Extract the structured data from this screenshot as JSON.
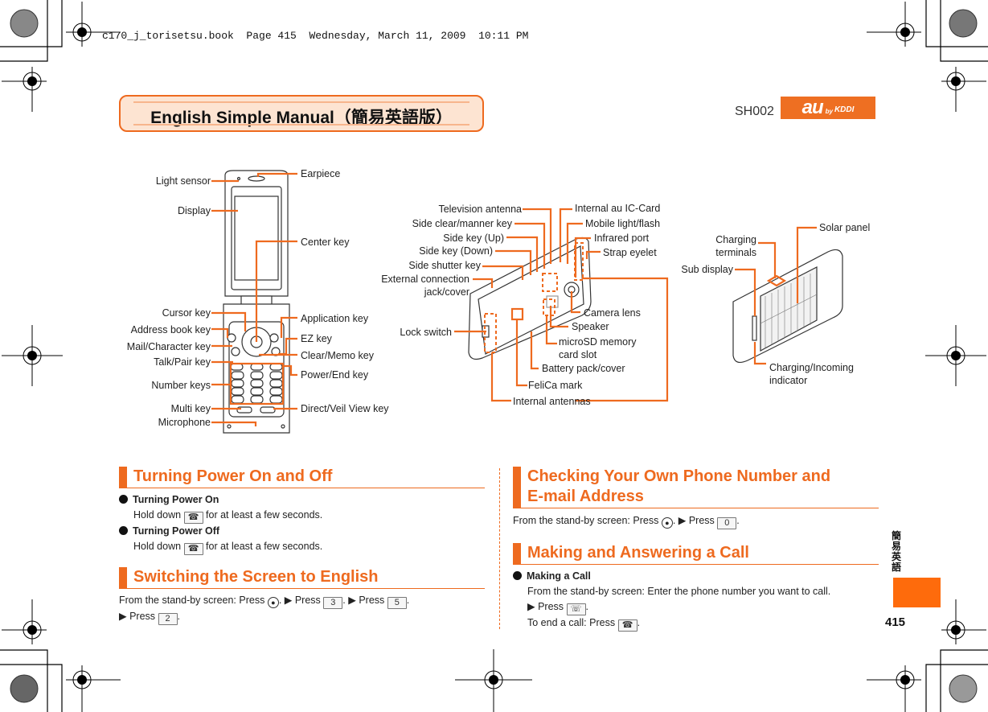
{
  "print_header": "c170_j_torisetsu.book  Page 415  Wednesday, March 11, 2009  10:11 PM",
  "banner": {
    "title": "English Simple Manual（簡易英語版）"
  },
  "model": "SH002",
  "brand_logo": {
    "main": "au",
    "by": "by",
    "kddi": "KDDI",
    "color": "#ee6f22"
  },
  "accent_color": "#ee6a1f",
  "diagram_front": {
    "left_labels": [
      "Light sensor",
      "Display",
      "Cursor key",
      "Address book key",
      "Mail/Character key",
      "Talk/Pair key",
      "Number keys",
      "Multi key",
      "Microphone"
    ],
    "right_labels": [
      "Earpiece",
      "Center key",
      "Application key",
      "EZ key",
      "Clear/Memo key",
      "Power/End key",
      "Direct/Veil View key"
    ]
  },
  "diagram_back": {
    "left_labels": [
      "Television antenna",
      "Side clear/manner key",
      "Side key (Up)",
      "Side key (Down)",
      "Side shutter key",
      "External connection",
      "jack/cover",
      "Lock switch"
    ],
    "right_labels": [
      "Internal au IC-Card",
      "Mobile light/flash",
      "Infrared port",
      "Strap eyelet",
      "Camera lens",
      "Speaker",
      "microSD memory",
      "card slot",
      "Battery pack/cover",
      "FeliCa mark",
      "Internal antennas"
    ]
  },
  "diagram_closed": {
    "labels": [
      "Charging",
      "terminals",
      "Solar panel",
      "Sub display",
      "Charging/Incoming",
      "indicator"
    ]
  },
  "sections": {
    "power": {
      "heading": "Turning Power On and Off",
      "items": [
        {
          "title": "Turning Power On",
          "text_a": "Hold down",
          "key": "☎",
          "text_b": "for at least a few seconds."
        },
        {
          "title": "Turning Power Off",
          "text_a": "Hold down",
          "key": "☎",
          "text_b": "for at least a few seconds."
        }
      ]
    },
    "english": {
      "heading": "Switching the Screen to English",
      "line1_a": "From the stand-by screen: Press",
      "line1_b": ". ▶ Press",
      "key1": "3",
      "line1_c": ". ▶ Press",
      "key2": "5",
      "line1_d": ".",
      "line2_a": "▶ Press",
      "key3": "2",
      "line2_b": "."
    },
    "own_number": {
      "heading_line1": "Checking Your Own Phone Number and",
      "heading_line2": "E-mail Address",
      "text_a": "From the stand-by screen: Press",
      "text_b": ". ▶ Press",
      "key": "0",
      "text_c": "."
    },
    "call": {
      "heading": "Making and Answering a Call",
      "item_title": "Making a Call",
      "line1": "From the stand-by screen: Enter the phone number you want to call.",
      "line2_a": "▶ Press",
      "key_talk": "☏",
      "line2_b": ".",
      "line3_a": "To end a call: Press",
      "key_end": "☎",
      "line3_b": "."
    }
  },
  "side_tab_text": "簡易英語",
  "page_number": "415"
}
